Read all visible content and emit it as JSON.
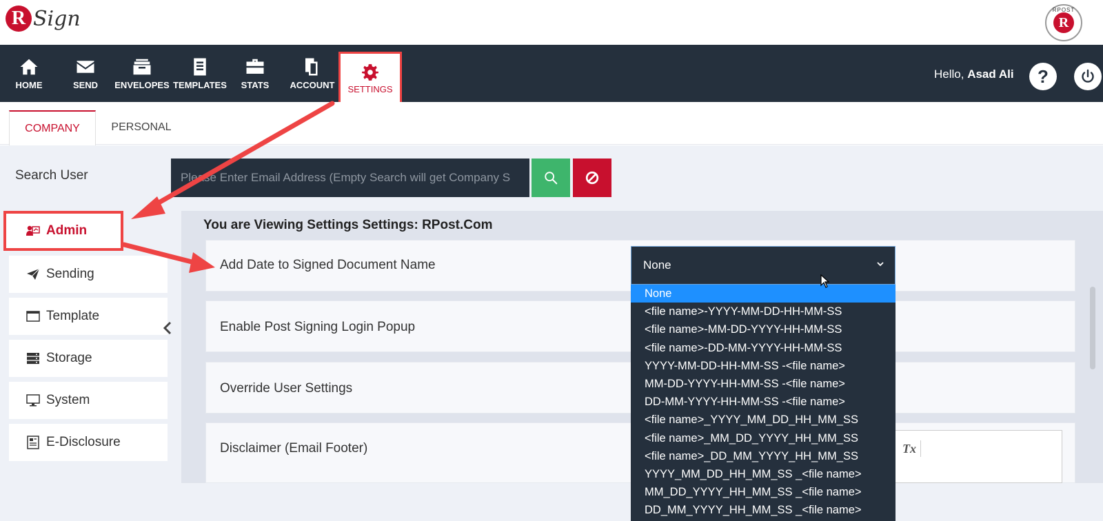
{
  "brand": {
    "logo_letter": "R",
    "logo_word": "Sign",
    "badge_text": "RPOST",
    "badge_letter": "R"
  },
  "nav": {
    "items": [
      {
        "label": "HOME",
        "icon": "home-icon"
      },
      {
        "label": "SEND",
        "icon": "envelope-icon"
      },
      {
        "label": "ENVELOPES",
        "icon": "inbox-icon"
      },
      {
        "label": "TEMPLATES",
        "icon": "document-icon"
      },
      {
        "label": "STATS",
        "icon": "briefcase-icon"
      },
      {
        "label": "ACCOUNT",
        "icon": "copy-icon"
      },
      {
        "label": "SETTINGS",
        "icon": "gear-icon"
      }
    ],
    "greeting": "Hello, ",
    "user_name": "Asad Ali",
    "help_label": "?"
  },
  "tabs": {
    "company": "COMPANY",
    "personal": "PERSONAL"
  },
  "search": {
    "label": "Search User",
    "placeholder": "Please Enter Email Address (Empty Search will get Company S"
  },
  "sidebar": {
    "items": [
      {
        "label": "Admin",
        "icon": "admin-icon",
        "active": true
      },
      {
        "label": "Sending",
        "icon": "paper-plane-icon"
      },
      {
        "label": "Template",
        "icon": "window-icon"
      },
      {
        "label": "Storage",
        "icon": "server-icon"
      },
      {
        "label": "System",
        "icon": "monitor-icon"
      },
      {
        "label": "E-Disclosure",
        "icon": "newspaper-icon"
      }
    ]
  },
  "panel": {
    "title": "You are Viewing Settings Settings: RPost.Com",
    "rows": [
      {
        "label": "Add Date to Signed Document Name"
      },
      {
        "label": "Enable Post Signing Login Popup"
      },
      {
        "label": "Override User Settings"
      },
      {
        "label": "Disclaimer (Email Footer)"
      }
    ],
    "editor_clear_format": "Tx"
  },
  "select": {
    "value": "None",
    "options": [
      "None",
      "<file name>-YYYY-MM-DD-HH-MM-SS",
      "<file name>-MM-DD-YYYY-HH-MM-SS",
      "<file name>-DD-MM-YYYY-HH-MM-SS",
      "YYYY-MM-DD-HH-MM-SS -<file name>",
      "MM-DD-YYYY-HH-MM-SS -<file name>",
      "DD-MM-YYYY-HH-MM-SS -<file name>",
      "<file name>_YYYY_MM_DD_HH_MM_SS",
      "<file name>_MM_DD_YYYY_HH_MM_SS",
      "<file name>_DD_MM_YYYY_HH_MM_SS",
      "YYYY_MM_DD_HH_MM_SS _<file name>",
      "MM_DD_YYYY_HH_MM_SS _<file name>",
      "DD_MM_YYYY_HH_MM_SS _<file name>"
    ]
  },
  "colors": {
    "navy": "#25303d",
    "brand_red": "#c8102e",
    "annotation_red": "#ee4444",
    "success_green": "#3eb56c",
    "highlight_blue": "#1e90ff"
  }
}
